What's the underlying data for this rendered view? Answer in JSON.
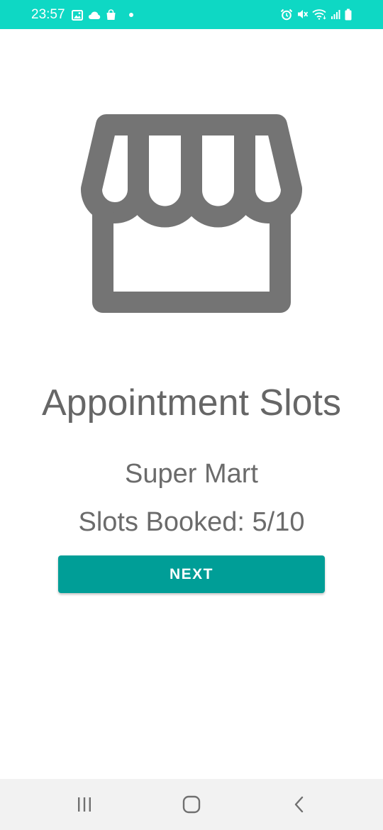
{
  "status_bar": {
    "time": "23:57",
    "background_color": "#0ed8c4",
    "left_icons": [
      "image-icon",
      "cloud-icon",
      "shopping-bag-icon",
      "dot-icon"
    ],
    "right_icons": [
      "alarm-icon",
      "mute-icon",
      "wifi-icon",
      "signal-icon",
      "battery-icon"
    ]
  },
  "main": {
    "icon": "store-icon",
    "title": "Appointment Slots",
    "store_name": "Super Mart",
    "slots_text": "Slots Booked: 5/10",
    "slots_booked": 5,
    "slots_total": 10,
    "next_label": "NEXT",
    "accent_color": "#009e97",
    "icon_color": "#747474"
  },
  "nav_bar": {
    "buttons": [
      "recent-apps-icon",
      "home-icon",
      "back-icon"
    ]
  }
}
